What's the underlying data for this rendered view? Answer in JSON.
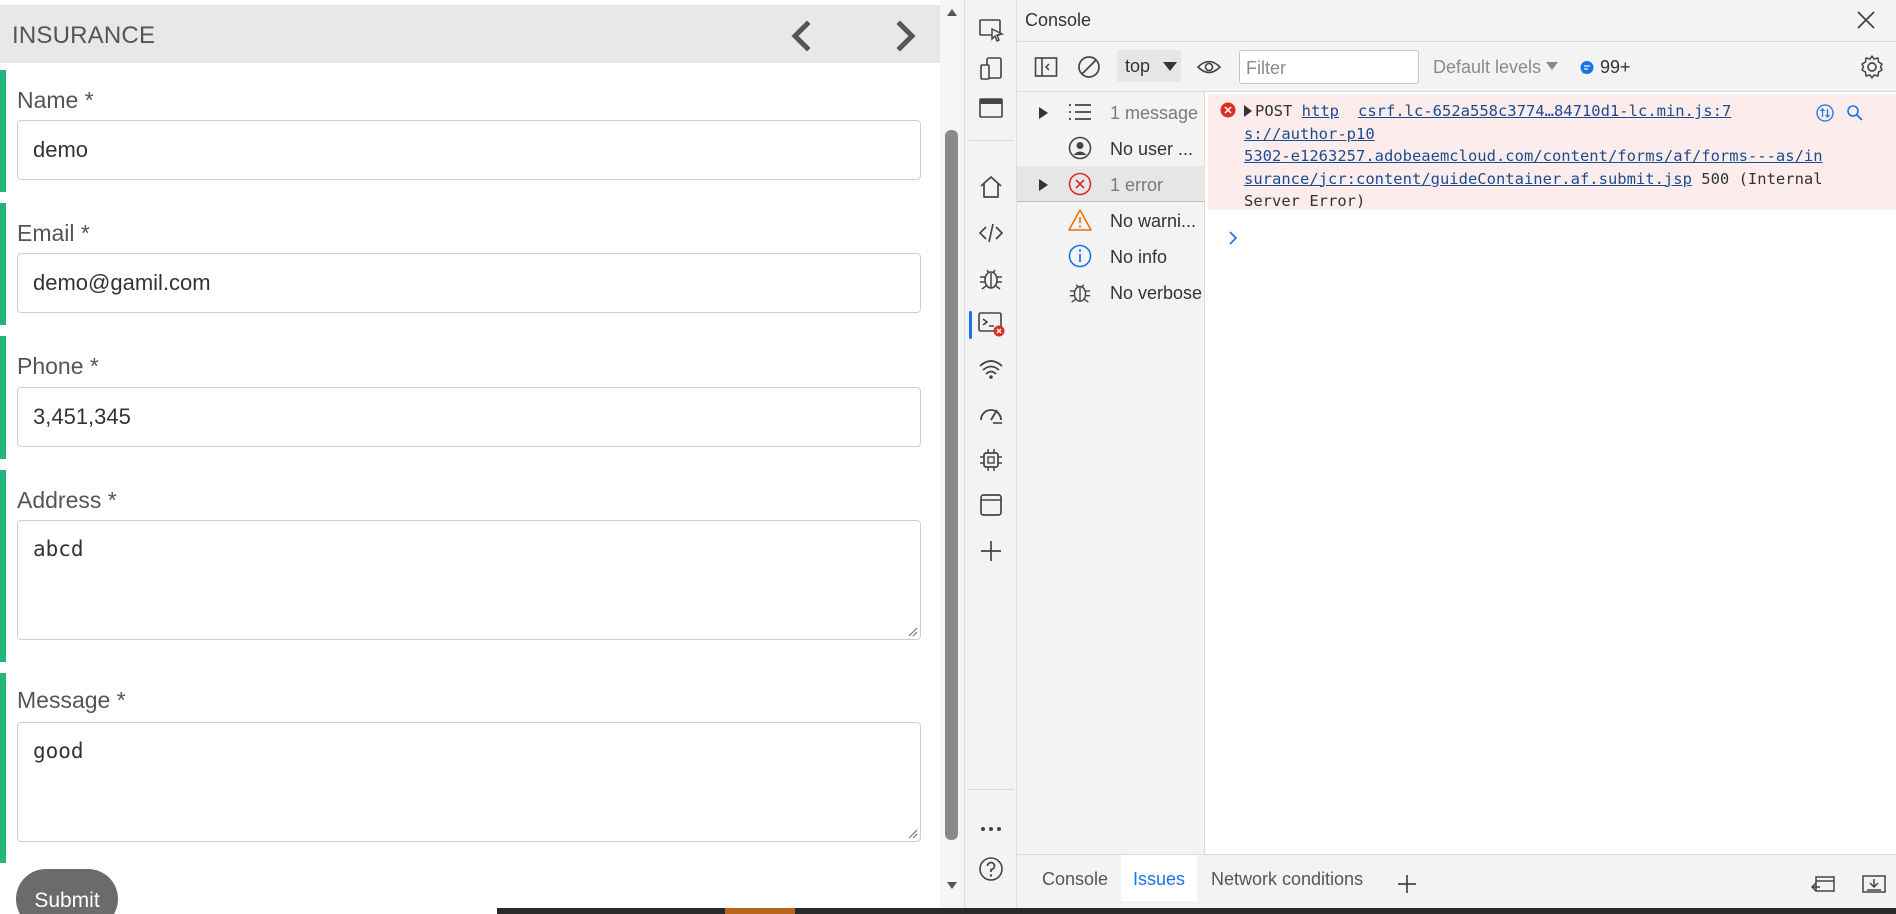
{
  "form": {
    "title": "INSURANCE",
    "fields": [
      {
        "label": "Name *",
        "value": "demo"
      },
      {
        "label": "Email *",
        "value": "demo@gamil.com"
      },
      {
        "label": "Phone *",
        "value": "3,451,345"
      },
      {
        "label": "Address *",
        "value": "abcd"
      },
      {
        "label": "Message *",
        "value": "good"
      }
    ],
    "submit_label": "Submit"
  },
  "devtools": {
    "panel_title": "Console",
    "toolbar": {
      "context": "top",
      "filter_placeholder": "Filter",
      "levels": "Default levels",
      "issues_count": "99+"
    },
    "sidebar": [
      {
        "label": "1 message",
        "icon": "list-icon",
        "expandable": true
      },
      {
        "label": "No user ...",
        "icon": "user-icon",
        "expandable": false
      },
      {
        "label": "1 error",
        "icon": "error-icon",
        "expandable": true
      },
      {
        "label": "No warni...",
        "icon": "warning-icon",
        "expandable": false
      },
      {
        "label": "No info",
        "icon": "info-icon",
        "expandable": false
      },
      {
        "label": "No verbose",
        "icon": "bug-icon",
        "expandable": false
      }
    ],
    "error": {
      "method": "POST",
      "url_line1": "http",
      "url_line2": "s://author-p10",
      "url_line3": "5302-e1263257.adobeaemcloud.com/content/forms/af/forms---as/in",
      "url_line4": "surance/jcr:content/guideContainer.af.submit.jsp",
      "status": " 500 (Internal",
      "status_line2": "Server Error)",
      "source": "csrf.lc-652a558c3774…84710d1-lc.min.js:7"
    },
    "bottom_tabs": [
      "Console",
      "Issues",
      "Network conditions"
    ],
    "active_tab": "Issues",
    "colors": {
      "field_accent": "#27b47b",
      "error_bg": "#fdecec",
      "error_red": "#d93025",
      "link_blue": "#1a4d8f",
      "active_blue": "#1a73e8",
      "warning_orange": "#e8710a"
    }
  }
}
